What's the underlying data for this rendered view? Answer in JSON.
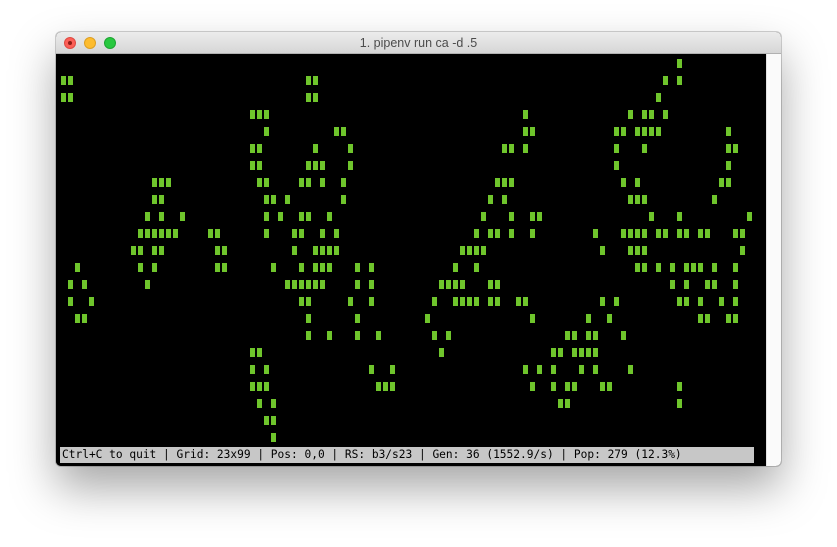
{
  "window": {
    "title": "1. pipenv run ca -d .5",
    "buttons": [
      "close-button",
      "minimize-button",
      "zoom-button"
    ]
  },
  "colors": {
    "cell": "#6fc52c",
    "background": "#000000",
    "status_bg": "#c7c7c7"
  },
  "status_bar": {
    "text": "Ctrl+C to quit | Grid: 23x99 | Pos: 0,0 | RS: b3/s23 | Gen: 36 (1552.9/s) | Pop: 279 (12.3%)"
  },
  "grid": {
    "rows": 23,
    "cols": 99,
    "live_cells": [
      [
        0,
        88
      ],
      [
        1,
        0
      ],
      [
        1,
        1
      ],
      [
        1,
        35
      ],
      [
        1,
        36
      ],
      [
        1,
        86
      ],
      [
        1,
        88
      ],
      [
        2,
        0
      ],
      [
        2,
        1
      ],
      [
        2,
        35
      ],
      [
        2,
        36
      ],
      [
        2,
        85
      ],
      [
        3,
        27
      ],
      [
        3,
        28
      ],
      [
        3,
        29
      ],
      [
        3,
        66
      ],
      [
        3,
        81
      ],
      [
        3,
        83
      ],
      [
        3,
        84
      ],
      [
        3,
        86
      ],
      [
        4,
        29
      ],
      [
        4,
        39
      ],
      [
        4,
        40
      ],
      [
        4,
        66
      ],
      [
        4,
        67
      ],
      [
        4,
        79
      ],
      [
        4,
        80
      ],
      [
        4,
        82
      ],
      [
        4,
        83
      ],
      [
        4,
        84
      ],
      [
        4,
        85
      ],
      [
        4,
        95
      ],
      [
        5,
        27
      ],
      [
        5,
        28
      ],
      [
        5,
        36
      ],
      [
        5,
        41
      ],
      [
        5,
        63
      ],
      [
        5,
        64
      ],
      [
        5,
        66
      ],
      [
        5,
        79
      ],
      [
        5,
        83
      ],
      [
        5,
        95
      ],
      [
        5,
        96
      ],
      [
        6,
        27
      ],
      [
        6,
        28
      ],
      [
        6,
        35
      ],
      [
        6,
        36
      ],
      [
        6,
        37
      ],
      [
        6,
        41
      ],
      [
        6,
        79
      ],
      [
        6,
        95
      ],
      [
        7,
        13
      ],
      [
        7,
        14
      ],
      [
        7,
        15
      ],
      [
        7,
        28
      ],
      [
        7,
        29
      ],
      [
        7,
        34
      ],
      [
        7,
        35
      ],
      [
        7,
        37
      ],
      [
        7,
        40
      ],
      [
        7,
        62
      ],
      [
        7,
        63
      ],
      [
        7,
        64
      ],
      [
        7,
        80
      ],
      [
        7,
        82
      ],
      [
        7,
        94
      ],
      [
        7,
        95
      ],
      [
        8,
        13
      ],
      [
        8,
        14
      ],
      [
        8,
        29
      ],
      [
        8,
        30
      ],
      [
        8,
        32
      ],
      [
        8,
        40
      ],
      [
        8,
        61
      ],
      [
        8,
        63
      ],
      [
        8,
        81
      ],
      [
        8,
        82
      ],
      [
        8,
        83
      ],
      [
        8,
        93
      ],
      [
        9,
        12
      ],
      [
        9,
        14
      ],
      [
        9,
        17
      ],
      [
        9,
        29
      ],
      [
        9,
        31
      ],
      [
        9,
        34
      ],
      [
        9,
        35
      ],
      [
        9,
        38
      ],
      [
        9,
        60
      ],
      [
        9,
        64
      ],
      [
        9,
        67
      ],
      [
        9,
        68
      ],
      [
        9,
        84
      ],
      [
        9,
        88
      ],
      [
        9,
        98
      ],
      [
        10,
        11
      ],
      [
        10,
        12
      ],
      [
        10,
        13
      ],
      [
        10,
        14
      ],
      [
        10,
        15
      ],
      [
        10,
        16
      ],
      [
        10,
        21
      ],
      [
        10,
        22
      ],
      [
        10,
        29
      ],
      [
        10,
        33
      ],
      [
        10,
        34
      ],
      [
        10,
        37
      ],
      [
        10,
        39
      ],
      [
        10,
        59
      ],
      [
        10,
        61
      ],
      [
        10,
        62
      ],
      [
        10,
        64
      ],
      [
        10,
        67
      ],
      [
        10,
        76
      ],
      [
        10,
        80
      ],
      [
        10,
        81
      ],
      [
        10,
        82
      ],
      [
        10,
        83
      ],
      [
        10,
        85
      ],
      [
        10,
        86
      ],
      [
        10,
        88
      ],
      [
        10,
        89
      ],
      [
        10,
        91
      ],
      [
        10,
        92
      ],
      [
        10,
        96
      ],
      [
        10,
        97
      ],
      [
        11,
        10
      ],
      [
        11,
        11
      ],
      [
        11,
        13
      ],
      [
        11,
        14
      ],
      [
        11,
        22
      ],
      [
        11,
        23
      ],
      [
        11,
        33
      ],
      [
        11,
        36
      ],
      [
        11,
        37
      ],
      [
        11,
        38
      ],
      [
        11,
        39
      ],
      [
        11,
        57
      ],
      [
        11,
        58
      ],
      [
        11,
        59
      ],
      [
        11,
        60
      ],
      [
        11,
        77
      ],
      [
        11,
        81
      ],
      [
        11,
        82
      ],
      [
        11,
        83
      ],
      [
        11,
        97
      ],
      [
        12,
        2
      ],
      [
        12,
        11
      ],
      [
        12,
        13
      ],
      [
        12,
        22
      ],
      [
        12,
        23
      ],
      [
        12,
        30
      ],
      [
        12,
        34
      ],
      [
        12,
        36
      ],
      [
        12,
        37
      ],
      [
        12,
        38
      ],
      [
        12,
        42
      ],
      [
        12,
        44
      ],
      [
        12,
        56
      ],
      [
        12,
        59
      ],
      [
        12,
        82
      ],
      [
        12,
        83
      ],
      [
        12,
        85
      ],
      [
        12,
        87
      ],
      [
        12,
        89
      ],
      [
        12,
        90
      ],
      [
        12,
        91
      ],
      [
        12,
        93
      ],
      [
        12,
        96
      ],
      [
        13,
        1
      ],
      [
        13,
        3
      ],
      [
        13,
        12
      ],
      [
        13,
        32
      ],
      [
        13,
        33
      ],
      [
        13,
        34
      ],
      [
        13,
        35
      ],
      [
        13,
        36
      ],
      [
        13,
        37
      ],
      [
        13,
        42
      ],
      [
        13,
        44
      ],
      [
        13,
        54
      ],
      [
        13,
        55
      ],
      [
        13,
        56
      ],
      [
        13,
        57
      ],
      [
        13,
        61
      ],
      [
        13,
        62
      ],
      [
        13,
        87
      ],
      [
        13,
        89
      ],
      [
        13,
        92
      ],
      [
        13,
        93
      ],
      [
        13,
        96
      ],
      [
        14,
        1
      ],
      [
        14,
        4
      ],
      [
        14,
        34
      ],
      [
        14,
        35
      ],
      [
        14,
        41
      ],
      [
        14,
        44
      ],
      [
        14,
        53
      ],
      [
        14,
        56
      ],
      [
        14,
        57
      ],
      [
        14,
        58
      ],
      [
        14,
        59
      ],
      [
        14,
        61
      ],
      [
        14,
        62
      ],
      [
        14,
        65
      ],
      [
        14,
        66
      ],
      [
        14,
        77
      ],
      [
        14,
        79
      ],
      [
        14,
        88
      ],
      [
        14,
        89
      ],
      [
        14,
        91
      ],
      [
        14,
        94
      ],
      [
        14,
        96
      ],
      [
        15,
        2
      ],
      [
        15,
        3
      ],
      [
        15,
        35
      ],
      [
        15,
        42
      ],
      [
        15,
        52
      ],
      [
        15,
        67
      ],
      [
        15,
        75
      ],
      [
        15,
        78
      ],
      [
        15,
        91
      ],
      [
        15,
        92
      ],
      [
        15,
        95
      ],
      [
        15,
        96
      ],
      [
        16,
        35
      ],
      [
        16,
        38
      ],
      [
        16,
        42
      ],
      [
        16,
        45
      ],
      [
        16,
        53
      ],
      [
        16,
        55
      ],
      [
        16,
        72
      ],
      [
        16,
        73
      ],
      [
        16,
        75
      ],
      [
        16,
        76
      ],
      [
        16,
        80
      ],
      [
        17,
        27
      ],
      [
        17,
        28
      ],
      [
        17,
        54
      ],
      [
        17,
        70
      ],
      [
        17,
        71
      ],
      [
        17,
        73
      ],
      [
        17,
        74
      ],
      [
        17,
        75
      ],
      [
        17,
        76
      ],
      [
        18,
        27
      ],
      [
        18,
        29
      ],
      [
        18,
        44
      ],
      [
        18,
        47
      ],
      [
        18,
        66
      ],
      [
        18,
        68
      ],
      [
        18,
        70
      ],
      [
        18,
        74
      ],
      [
        18,
        76
      ],
      [
        18,
        81
      ],
      [
        19,
        27
      ],
      [
        19,
        28
      ],
      [
        19,
        29
      ],
      [
        19,
        45
      ],
      [
        19,
        46
      ],
      [
        19,
        47
      ],
      [
        19,
        67
      ],
      [
        19,
        70
      ],
      [
        19,
        72
      ],
      [
        19,
        73
      ],
      [
        19,
        77
      ],
      [
        19,
        78
      ],
      [
        19,
        88
      ],
      [
        20,
        28
      ],
      [
        20,
        30
      ],
      [
        20,
        71
      ],
      [
        20,
        72
      ],
      [
        20,
        88
      ],
      [
        21,
        29
      ],
      [
        21,
        30
      ],
      [
        22,
        30
      ]
    ]
  }
}
